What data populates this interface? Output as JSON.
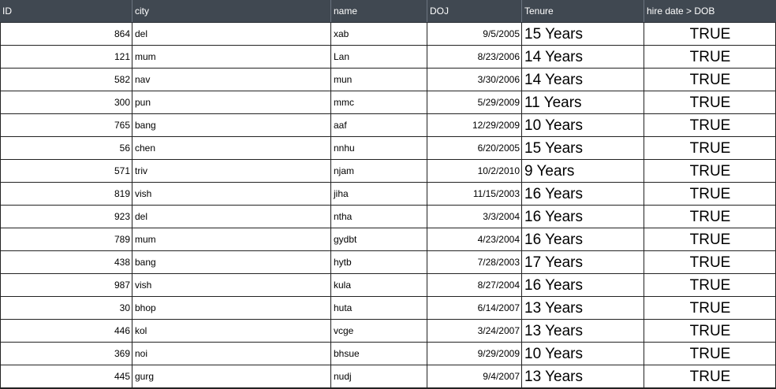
{
  "columns": {
    "id": "ID",
    "city": "city",
    "name": "name",
    "doj": "DOJ",
    "tenure": "Tenure",
    "hire": "hire date > DOB"
  },
  "rows": [
    {
      "id": "864",
      "city": "del",
      "name": "xab",
      "doj": "9/5/2005",
      "tenure": "15 Years",
      "hire": "TRUE"
    },
    {
      "id": "121",
      "city": "mum",
      "name": "Lan",
      "doj": "8/23/2006",
      "tenure": "14 Years",
      "hire": "TRUE"
    },
    {
      "id": "582",
      "city": "nav",
      "name": "mun",
      "doj": "3/30/2006",
      "tenure": "14 Years",
      "hire": "TRUE"
    },
    {
      "id": "300",
      "city": "pun",
      "name": "mmc",
      "doj": "5/29/2009",
      "tenure": "11 Years",
      "hire": "TRUE"
    },
    {
      "id": "765",
      "city": "bang",
      "name": "aaf",
      "doj": "12/29/2009",
      "tenure": "10 Years",
      "hire": "TRUE"
    },
    {
      "id": "56",
      "city": "chen",
      "name": "nnhu",
      "doj": "6/20/2005",
      "tenure": "15 Years",
      "hire": "TRUE"
    },
    {
      "id": "571",
      "city": "triv",
      "name": "njam",
      "doj": "10/2/2010",
      "tenure": "9 Years",
      "hire": "TRUE"
    },
    {
      "id": "819",
      "city": "vish",
      "name": "jiha",
      "doj": "11/15/2003",
      "tenure": "16 Years",
      "hire": "TRUE"
    },
    {
      "id": "923",
      "city": "del",
      "name": "ntha",
      "doj": "3/3/2004",
      "tenure": "16 Years",
      "hire": "TRUE"
    },
    {
      "id": "789",
      "city": "mum",
      "name": "gydbt",
      "doj": "4/23/2004",
      "tenure": "16 Years",
      "hire": "TRUE"
    },
    {
      "id": "438",
      "city": "bang",
      "name": "hytb",
      "doj": "7/28/2003",
      "tenure": "17 Years",
      "hire": "TRUE"
    },
    {
      "id": "987",
      "city": "vish",
      "name": "kula",
      "doj": "8/27/2004",
      "tenure": "16 Years",
      "hire": "TRUE"
    },
    {
      "id": "30",
      "city": "bhop",
      "name": "huta",
      "doj": "6/14/2007",
      "tenure": "13 Years",
      "hire": "TRUE"
    },
    {
      "id": "446",
      "city": "kol",
      "name": "vcge",
      "doj": "3/24/2007",
      "tenure": "13 Years",
      "hire": "TRUE"
    },
    {
      "id": "369",
      "city": "noi",
      "name": "bhsue",
      "doj": "9/29/2009",
      "tenure": "10 Years",
      "hire": "TRUE"
    },
    {
      "id": "445",
      "city": "gurg",
      "name": "nudj",
      "doj": "9/4/2007",
      "tenure": "13 Years",
      "hire": "TRUE"
    }
  ],
  "colors": {
    "header_bg": "#404851",
    "header_text": "#ffffff",
    "grid_line": "#222222"
  }
}
